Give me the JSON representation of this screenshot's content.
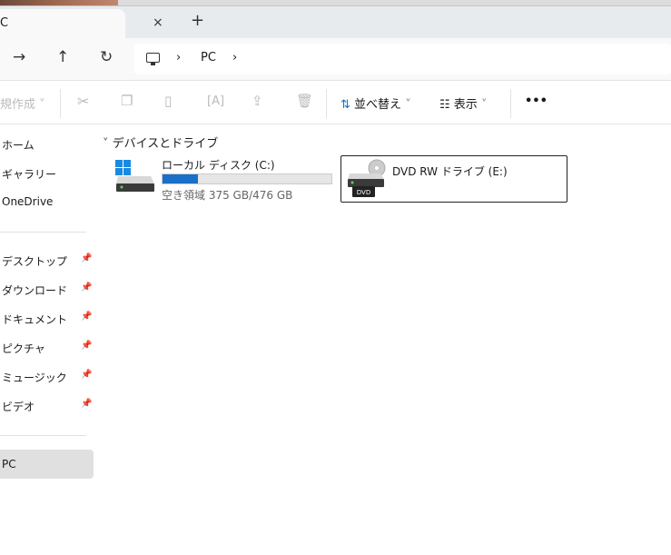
{
  "tab": {
    "title": "C",
    "close": "×",
    "new": "+"
  },
  "nav": {
    "forward": "→",
    "up": "↑",
    "refresh": "↻",
    "crumbs": [
      "PC"
    ],
    "sep": "›"
  },
  "toolbar": {
    "new_label": "規作成",
    "sort_label": "並べ替え",
    "view_label": "表示",
    "more": "•••"
  },
  "sidebar": {
    "items": [
      {
        "label": "ホーム"
      },
      {
        "label": "ギャラリー"
      },
      {
        "label": "OneDrive"
      },
      {
        "label": "デスクトップ",
        "pinned": true
      },
      {
        "label": "ダウンロード",
        "pinned": true
      },
      {
        "label": "ドキュメント",
        "pinned": true
      },
      {
        "label": "ピクチャ",
        "pinned": true
      },
      {
        "label": "ミュージック",
        "pinned": true
      },
      {
        "label": "ビデオ",
        "pinned": true
      },
      {
        "label": "PC",
        "selected": true
      }
    ]
  },
  "main": {
    "group": "デバイスとドライブ",
    "drives": [
      {
        "name": "ローカル ディスク (C:)",
        "free": "空き領域 375 GB/476 GB",
        "used_fraction": 0.21
      },
      {
        "name": "DVD RW ドライブ (E:)",
        "badge": "DVD"
      }
    ]
  },
  "colors": {
    "accent": "#1a6fc9"
  }
}
